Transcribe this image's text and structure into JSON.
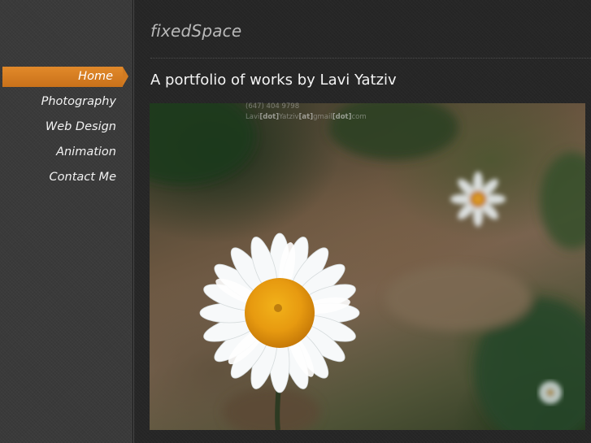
{
  "site": {
    "logo": "fixedSpace"
  },
  "nav": {
    "items": [
      {
        "label": "Home",
        "active": true
      },
      {
        "label": "Photography",
        "active": false
      },
      {
        "label": "Web Design",
        "active": false
      },
      {
        "label": "Animation",
        "active": false
      },
      {
        "label": "Contact Me",
        "active": false
      }
    ]
  },
  "main": {
    "title": "A portfolio of works by Lavi Yatziv",
    "contact": {
      "phone": "(647) 404 9798",
      "email_parts": [
        "Lavi",
        "[dot]",
        "Yatziv",
        "[at]",
        "gmail",
        "[dot]",
        "com"
      ]
    }
  },
  "colors": {
    "accent": "#d27b21",
    "background": "#262626",
    "sidebar": "#3a3a3a"
  },
  "icons": {
    "active_nav_marker": "arrow-right"
  }
}
